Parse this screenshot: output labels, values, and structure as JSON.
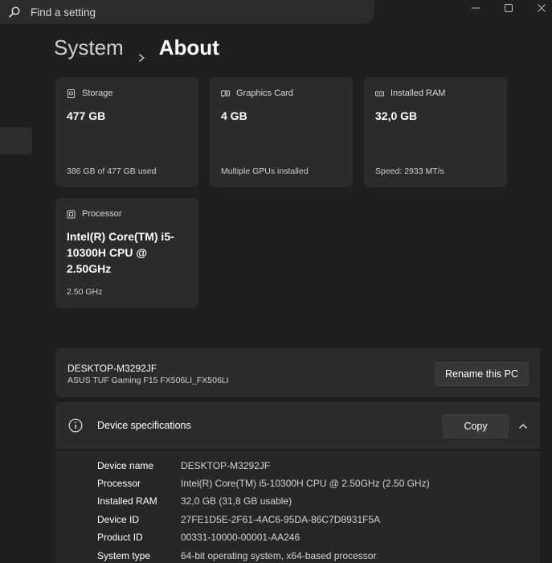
{
  "search": {
    "placeholder": "Find a setting",
    "icon": "search-icon"
  },
  "window_controls": [
    "minimize-icon",
    "maximize-icon",
    "close-icon"
  ],
  "breadcrumb": {
    "parent": "System",
    "current": "About"
  },
  "tiles": [
    {
      "label": "Storage",
      "value": "477 GB",
      "detail": "386 GB of 477 GB used",
      "icon": "storage-icon"
    },
    {
      "label": "Graphics Card",
      "value": "4 GB",
      "detail": "Multiple GPUs installed",
      "icon": "graphics-card-icon"
    },
    {
      "label": "Installed RAM",
      "value": "32,0 GB",
      "detail": "Speed: 2933 MT/s",
      "icon": "ram-icon"
    },
    {
      "label": "Processor",
      "value": "Intel(R) Core(TM) i5-10300H CPU @ 2.50GHz",
      "detail": "2.50 GHz",
      "icon": "processor-icon"
    }
  ],
  "pc": {
    "name": "DESKTOP-M3292JF",
    "model": "ASUS TUF Gaming F15 FX506LI_FX506LI",
    "rename_label": "Rename this PC"
  },
  "specs": {
    "title": "Device specifications",
    "copy_label": "Copy",
    "rows": [
      {
        "key": "Device name",
        "value": "DESKTOP-M3292JF"
      },
      {
        "key": "Processor",
        "value": "Intel(R) Core(TM) i5-10300H CPU @ 2.50GHz (2.50 GHz)"
      },
      {
        "key": "Installed RAM",
        "value": "32,0 GB (31,8 GB usable)"
      },
      {
        "key": "Device ID",
        "value": "27FE1D5E-2F61-4AC6-95DA-86C7D8931F5A"
      },
      {
        "key": "Product ID",
        "value": "00331-10000-00001-AA246"
      },
      {
        "key": "System type",
        "value": "64-bit operating system, x64-based processor"
      }
    ]
  },
  "colors": {
    "background": "#1f1f1f",
    "card": "#2b2b2b",
    "button": "#373737"
  }
}
